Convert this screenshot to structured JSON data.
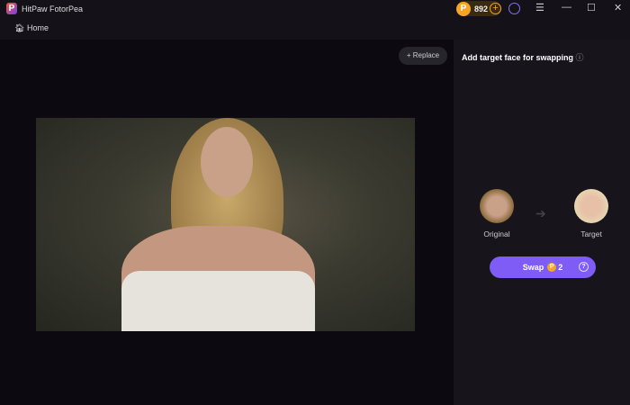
{
  "app": {
    "title": "HitPaw FotorPea",
    "coins": "892"
  },
  "nav": {
    "home": "Home"
  },
  "canvas": {
    "replace": "Replace"
  },
  "panel": {
    "title": "Add target face for swapping",
    "original": "Original",
    "target": "Target",
    "swap": "Swap",
    "cost": "2"
  }
}
